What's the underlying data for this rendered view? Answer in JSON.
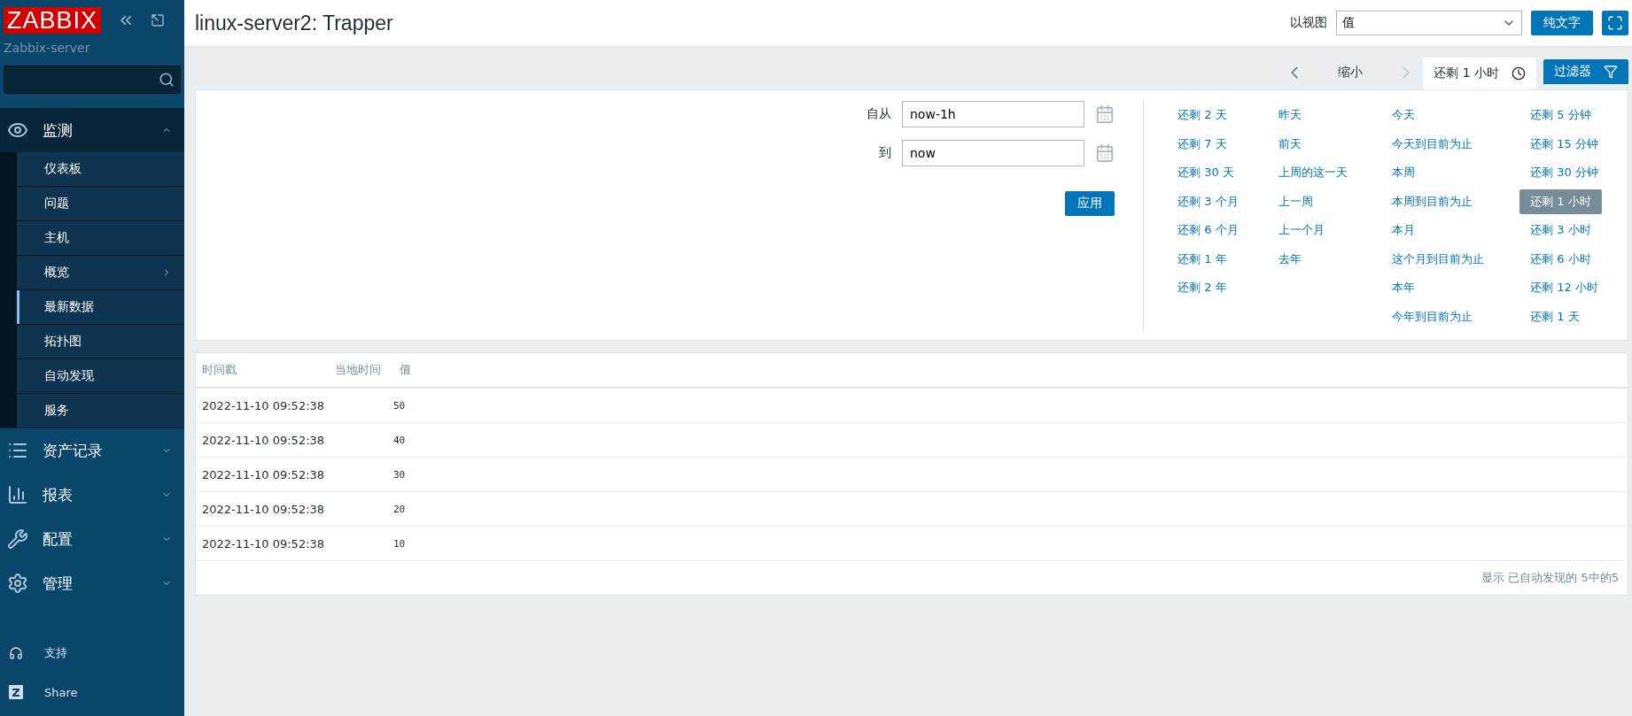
{
  "sidebar": {
    "logo": "ZABBIX",
    "server_name": "Zabbix-server",
    "menu": [
      {
        "label": "监测",
        "expanded": true,
        "children": [
          {
            "label": "仪表板",
            "selected": false,
            "has_submenu": false
          },
          {
            "label": "问题",
            "selected": false,
            "has_submenu": false
          },
          {
            "label": "主机",
            "selected": false,
            "has_submenu": false
          },
          {
            "label": "概览",
            "selected": false,
            "has_submenu": true
          },
          {
            "label": "最新数据",
            "selected": true,
            "has_submenu": false
          },
          {
            "label": "拓扑图",
            "selected": false,
            "has_submenu": false
          },
          {
            "label": "自动发现",
            "selected": false,
            "has_submenu": false
          },
          {
            "label": "服务",
            "selected": false,
            "has_submenu": false
          }
        ]
      },
      {
        "label": "资产记录",
        "expanded": false
      },
      {
        "label": "报表",
        "expanded": false
      },
      {
        "label": "配置",
        "expanded": false
      },
      {
        "label": "管理",
        "expanded": false
      }
    ],
    "footer": [
      {
        "label": "支持"
      },
      {
        "label": "Share"
      }
    ]
  },
  "header": {
    "title": "linux-server2: Trapper",
    "view_label": "以视图",
    "view_value": "值",
    "plain_text_button": "纯文字"
  },
  "timeline": {
    "zoom_out": "缩小",
    "tabs": [
      {
        "label": "还剩 1 小时",
        "selected": true
      },
      {
        "label": "过滤器",
        "selected": false
      }
    ]
  },
  "filter": {
    "from_label": "自从",
    "from_value": "now-1h",
    "to_label": "到",
    "to_value": "now",
    "apply": "应用",
    "presets": [
      [
        {
          "label": "还剩 2 天",
          "selected": false
        },
        {
          "label": "还剩 7 天",
          "selected": false
        },
        {
          "label": "还剩 30 天",
          "selected": false
        },
        {
          "label": "还剩 3 个月",
          "selected": false
        },
        {
          "label": "还剩 6 个月",
          "selected": false
        },
        {
          "label": "还剩 1 年",
          "selected": false
        },
        {
          "label": "还剩 2 年",
          "selected": false
        }
      ],
      [
        {
          "label": "昨天",
          "selected": false
        },
        {
          "label": "前天",
          "selected": false
        },
        {
          "label": "上周的这一天",
          "selected": false
        },
        {
          "label": "上一周",
          "selected": false
        },
        {
          "label": "上一个月",
          "selected": false
        },
        {
          "label": "去年",
          "selected": false
        }
      ],
      [
        {
          "label": "今天",
          "selected": false
        },
        {
          "label": "今天到目前为止",
          "selected": false
        },
        {
          "label": "本周",
          "selected": false
        },
        {
          "label": "本周到目前为止",
          "selected": false
        },
        {
          "label": "本月",
          "selected": false
        },
        {
          "label": "这个月到目前为止",
          "selected": false
        },
        {
          "label": "本年",
          "selected": false
        },
        {
          "label": "今年到目前为止",
          "selected": false
        }
      ],
      [
        {
          "label": "还剩 5 分钟",
          "selected": false
        },
        {
          "label": "还剩 15 分钟",
          "selected": false
        },
        {
          "label": "还剩 30 分钟",
          "selected": false
        },
        {
          "label": "还剩 1 小时",
          "selected": true
        },
        {
          "label": "还剩 3 小时",
          "selected": false
        },
        {
          "label": "还剩 6 小时",
          "selected": false
        },
        {
          "label": "还剩 12 小时",
          "selected": false
        },
        {
          "label": "还剩 1 天",
          "selected": false
        }
      ]
    ]
  },
  "table": {
    "columns": [
      "时间戳",
      "当地时间",
      "值"
    ],
    "rows": [
      {
        "timestamp": "2022-11-10 09:52:38",
        "value": "50"
      },
      {
        "timestamp": "2022-11-10 09:52:38",
        "value": "40"
      },
      {
        "timestamp": "2022-11-10 09:52:38",
        "value": "30"
      },
      {
        "timestamp": "2022-11-10 09:52:38",
        "value": "20"
      },
      {
        "timestamp": "2022-11-10 09:52:38",
        "value": "10"
      }
    ],
    "footer": "显示 已自动发现的 5中的5"
  }
}
